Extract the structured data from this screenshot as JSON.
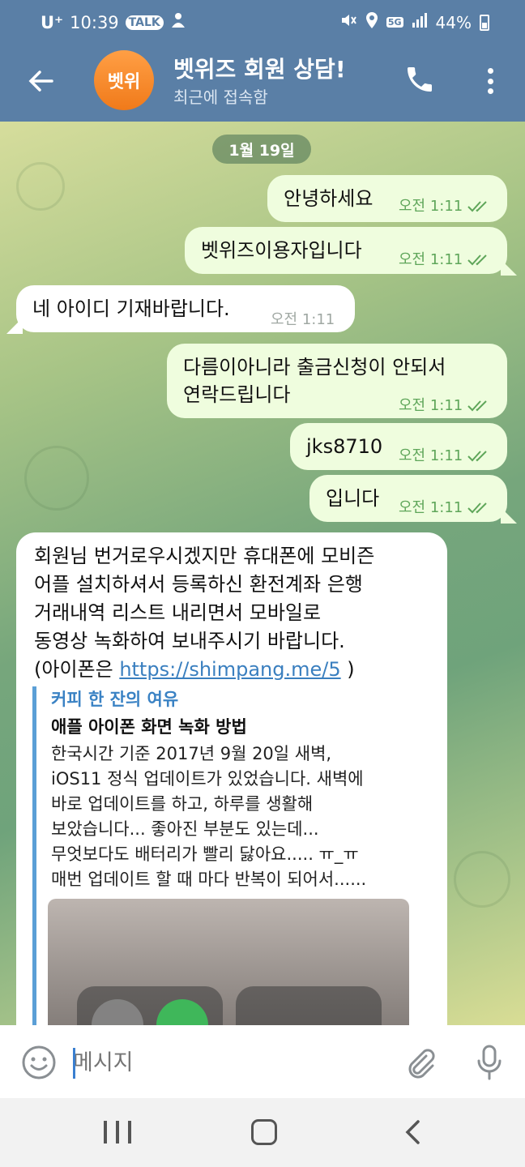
{
  "status": {
    "carrier": "U⁺",
    "time": "10:39",
    "talk_badge": "TALK",
    "battery": "44%",
    "network": "5G"
  },
  "header": {
    "title": "벳위즈 회원 상담!",
    "subtitle": "최근에 접속함",
    "avatar_text": "벳위"
  },
  "chat": {
    "date": "1월 19일",
    "messages": [
      {
        "dir": "out",
        "text": "안녕하세요",
        "time": "오전 1:11"
      },
      {
        "dir": "out",
        "text": "벳위즈이용자입니다",
        "time": "오전 1:11"
      },
      {
        "dir": "in",
        "text": "네 아이디 기재바랍니다.",
        "time": "오전 1:11"
      },
      {
        "dir": "out",
        "text_line1": "다름이아니라 출금신청이 안되서",
        "text_line2": "연락드립니다",
        "time": "오전 1:11"
      },
      {
        "dir": "out",
        "text": "jks8710",
        "time": "오전 1:11"
      },
      {
        "dir": "out",
        "text": "입니다",
        "time": "오전 1:11"
      }
    ],
    "long_message": {
      "line1": "회원님 번거로우시겠지만 휴대폰에 모비즌",
      "line2": "어플 설치하셔서 등록하신 환전계좌 은행",
      "line3": "거래내역 리스트 내리면서 모바일로",
      "line4": "동영상 녹화하여 보내주시기 바랍니다.",
      "line5_prefix": "(아이폰은 ",
      "link": "https://shimpang.me/5",
      "line5_suffix": " )"
    },
    "link_preview": {
      "site": "커피 한 잔의 여유",
      "title": "애플 아이폰 화면 녹화 방법",
      "desc1": "한국시간 기준 2017년 9월 20일 새벽,",
      "desc2": "iOS11 정식 업데이트가 있었습니다. 새벽에",
      "desc3": "바로 업데이트를 하고, 하루를 생활해",
      "desc4": "보았습니다... 좋아진 부분도 있는데...",
      "desc5": "무엇보다도 배터리가 빨리 닳아요..... ㅠ_ㅠ",
      "desc6": "매번 업데이트 할 때 마다 반복이 되어서......"
    }
  },
  "input": {
    "placeholder": "메시지"
  },
  "colors": {
    "header_bg": "#5a7fa6",
    "out_bubble": "#effdde",
    "in_bubble": "#ffffff",
    "check_green": "#5fa65a",
    "avatar_orange": "#f07a1a",
    "link_blue": "#3a7fbf"
  }
}
